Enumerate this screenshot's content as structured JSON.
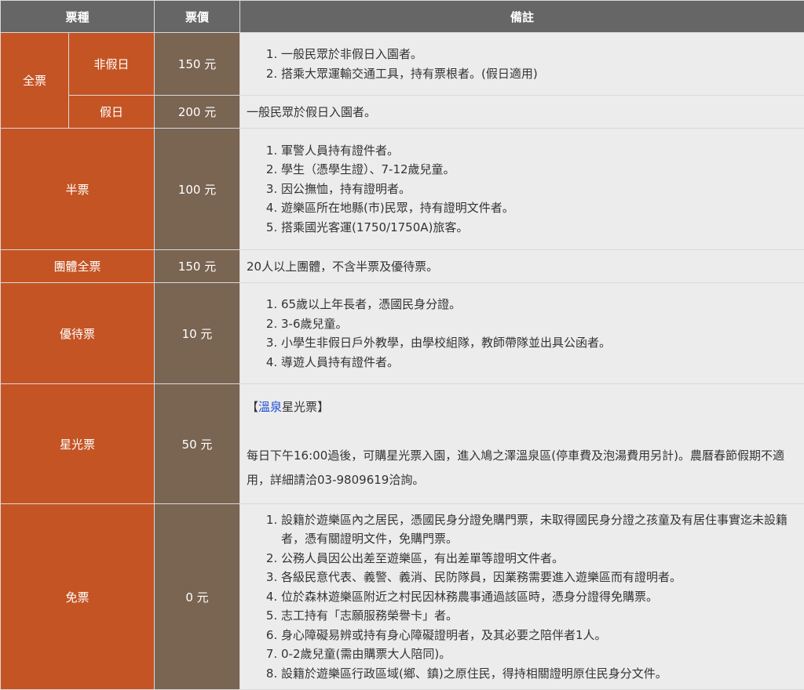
{
  "header": {
    "col_type": "票種",
    "col_price": "票價",
    "col_note": "備註"
  },
  "rows": {
    "full_weekday": {
      "group": "全票",
      "sub": "非假日",
      "price": "150 元",
      "notes": [
        "一般民眾於非假日入園者。",
        "搭乘大眾運輸交通工具，持有票根者。(假日適用)"
      ]
    },
    "full_holiday": {
      "sub": "假日",
      "price": "200 元",
      "note": "一般民眾於假日入園者。"
    },
    "half": {
      "label": "半票",
      "price": "100 元",
      "notes": [
        "軍警人員持有證件者。",
        "學生（憑學生證）、7-12歲兒童。",
        "因公撫恤，持有證明者。",
        "遊樂區所在地縣(市)民眾，持有證明文件者。",
        "搭乘國光客運(1750/1750A)旅客。"
      ]
    },
    "group": {
      "label": "團體全票",
      "price": "150 元",
      "note": "20人以上團體，不含半票及優待票。"
    },
    "discount": {
      "label": "優待票",
      "price": "10 元",
      "notes": [
        "65歲以上年長者，憑國民身分證。",
        "3-6歲兒童。",
        "小學生非假日戶外教學，由學校組隊，教師帶隊並出具公函者。",
        "導遊人員持有證件者。"
      ]
    },
    "starlight": {
      "label": "星光票",
      "price": "50 元",
      "bracket_open": "【",
      "link_text": "溫泉",
      "title_rest": "星光票",
      "bracket_close": "】",
      "body": "每日下午16:00過後，可購星光票入園，進入鳩之澤溫泉區(停車費及泡湯費用另計)。農曆春節假期不適用，詳細請洽03-9809619洽詢。"
    },
    "free": {
      "label": "免票",
      "price": "0 元",
      "notes": [
        "設籍於遊樂區內之居民，憑國民身分證免購門票，未取得國民身分證之孩童及有居住事實迄未設籍者，憑有關證明文件，免購門票。",
        "公務人員因公出差至遊樂區，有出差單等證明文件者。",
        "各級民意代表、義警、義消、民防隊員，因業務需要進入遊樂區而有證明者。",
        "位於森林遊樂區附近之村民因林務農事通過該區時，憑身分證得免購票。",
        "志工持有「志願服務榮譽卡」者。",
        "身心障礙易辨或持有身心障礙證明者，及其必要之陪伴者1人。",
        "0-2歲兒童(需由購票大人陪同)。",
        "設籍於遊樂區行政區域(鄉、鎮)之原住民，得持相關證明原住民身分文件。"
      ]
    }
  }
}
